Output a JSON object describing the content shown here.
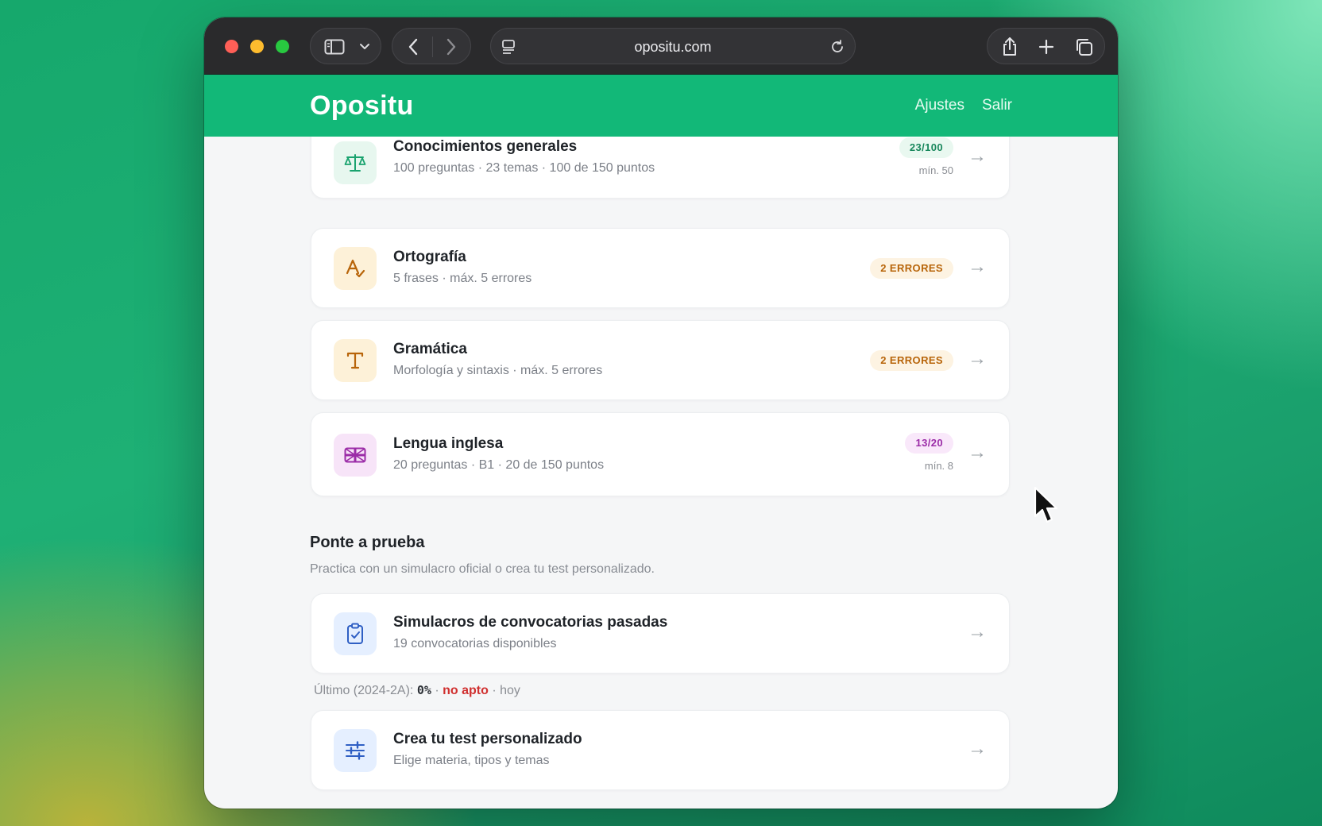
{
  "browser": {
    "url": "opositu.com"
  },
  "header": {
    "brand": "Opositu",
    "nav": [
      "Ajustes",
      "Salir"
    ]
  },
  "subjects": [
    {
      "title": "Conocimientos generales",
      "subtitle": "100 preguntas · 23 temas · 100 de 150 puntos",
      "badge": "23/100",
      "note": "mín. 50",
      "icon": "scale-icon",
      "accent": "#1aa36f"
    },
    {
      "title": "Ortografía",
      "subtitle": "5 frases · máx. 5 errores",
      "badge": "2 ERRORES",
      "icon": "spellcheck-icon",
      "accent": "#b8650a"
    },
    {
      "title": "Gramática",
      "subtitle": "Morfología y sintaxis · máx. 5 errores",
      "badge": "2 ERRORES",
      "icon": "text-icon",
      "accent": "#b8650a"
    },
    {
      "title": "Lengua inglesa",
      "subtitle": "20 preguntas · B1 · 20 de 150 puntos",
      "badge": "13/20",
      "note": "mín. 8",
      "icon": "uk-flag-icon",
      "accent": "#9b2ca7"
    }
  ],
  "practice": {
    "title": "Ponte a prueba",
    "subtitle": "Practica con un simulacro oficial o crea tu test personalizado.",
    "cards": [
      {
        "title": "Simulacros de convocatorias pasadas",
        "subtitle": "19 convocatorias disponibles",
        "icon": "clipboard-check-icon"
      },
      {
        "title": "Crea tu test personalizado",
        "subtitle": "Elige materia, tipos y temas",
        "icon": "sliders-icon"
      }
    ],
    "last_result": {
      "label": "Último (2024-2A):",
      "score": "0%",
      "sep1": "·",
      "status": "no apto",
      "sep2": "·",
      "when": "hoy"
    }
  },
  "arrow": "→"
}
